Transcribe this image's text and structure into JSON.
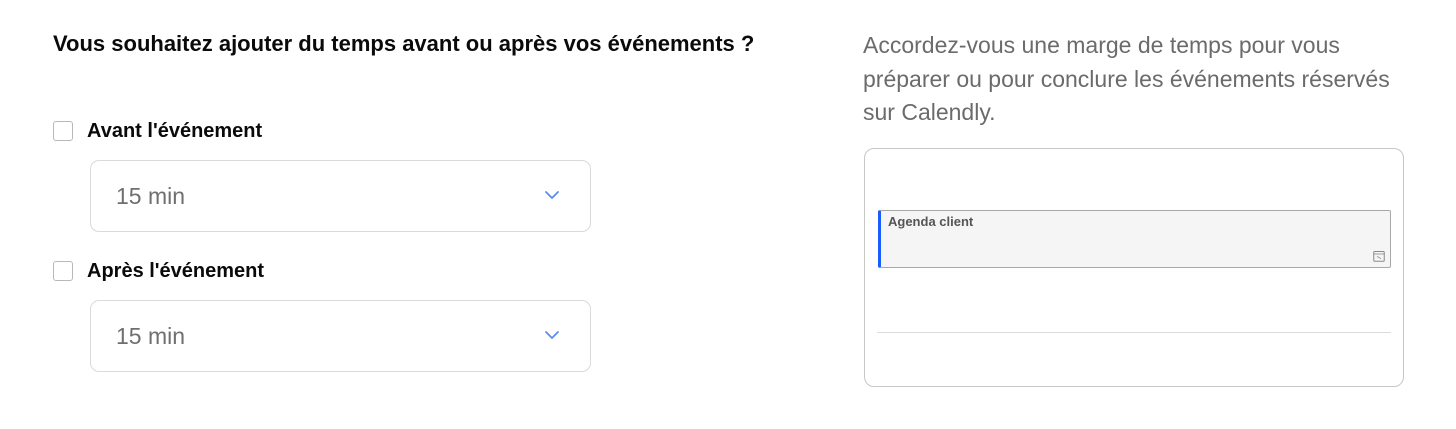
{
  "buffer": {
    "heading": "Vous souhaitez ajouter du temps avant ou après vos événements ?",
    "before": {
      "label": "Avant l'événement",
      "checked": false,
      "value": "15 min"
    },
    "after": {
      "label": "Après l'événement",
      "checked": false,
      "value": "15 min"
    }
  },
  "info": {
    "description": "Accordez-vous une marge de temps pour vous préparer ou pour conclure les événements réservés sur Calendly."
  },
  "preview": {
    "event_title": "Agenda client",
    "event_icon": "calendar-icon"
  },
  "colors": {
    "accent": "#1a5cff",
    "chevron": "#5b8def",
    "text": "#0a0a0a",
    "muted": "#6b6b6b"
  }
}
